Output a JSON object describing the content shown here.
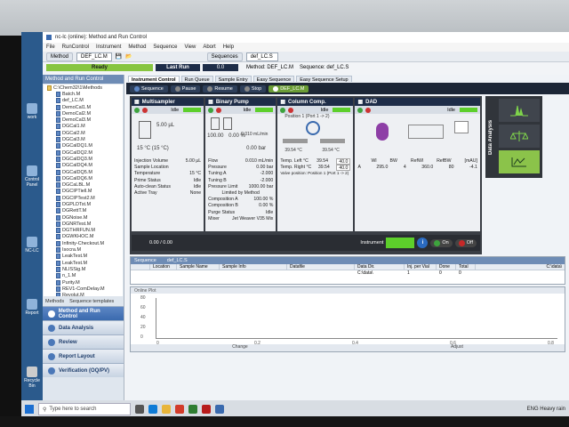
{
  "window": {
    "title": "nc-lc (online): Method and Run Control",
    "menu": [
      "File",
      "RunControl",
      "Instrument",
      "Method",
      "Sequence",
      "View",
      "Abort",
      "Help"
    ]
  },
  "toolbar": {
    "method_label": "Method",
    "method_value": "DEF_LC.M",
    "sequences_label": "Sequences",
    "sequence_value": "def_LC.S"
  },
  "status": {
    "ready": "Ready",
    "last_run": "Last Run",
    "last_run_value": "0.0",
    "method_file": "Method: DEF_LC.M",
    "sequence_file": "Sequence: def_LC.S"
  },
  "nav": {
    "title": "Method and Run Control",
    "root": "C:\\Chem32\\1\\Methods",
    "items": [
      "Batch.M",
      "def_LC.M",
      "DemoCal1.M",
      "DemoCal2.M",
      "DemoCal3.M",
      "DGCal1.M",
      "DGCal2.M",
      "DGCal3.M",
      "DGCalDQ1.M",
      "DGCalDQ2.M",
      "DGCalDQ3.M",
      "DGCalDQ4.M",
      "DGCalDQ5.M",
      "DGCalDQ6.M",
      "DGCaLBL.M",
      "DGCIPTiell.M",
      "DGCIPTest2.M",
      "DGPLDTst.M",
      "DGRettT.M",
      "DGNoise.M",
      "DGNRTest.M",
      "DGTHRFUN.M",
      "DGWKHOC.M",
      "Infinity-Checkout.M",
      "Isocra.M",
      "LeakTest.M",
      "LeakTest.M",
      "NLISSig.M",
      "n_1.M",
      "Purity.M",
      "REV1-ComDelay.M",
      "Revolut.M",
      "RSLC1Check.M"
    ],
    "tabs": [
      "Methods",
      "Sequence templates"
    ],
    "views": [
      "Method and Run Control",
      "Data Analysis",
      "Review",
      "Report Layout",
      "Verification (OQ/PV)"
    ]
  },
  "main_tabs": [
    "Instrument Control",
    "Run Queue",
    "Sample Entry",
    "Easy Sequence",
    "Easy Sequence Setup"
  ],
  "seqbar": {
    "buttons": [
      "Sequence",
      "Pause",
      "Resume",
      "Stop"
    ],
    "method": "DEF_LC.M"
  },
  "modules": {
    "sampler": {
      "title": "Multisampler",
      "idle": "Idle",
      "volume": "5.00 µL",
      "temp": "15 °C (15 °C)",
      "rows": [
        [
          "Injection Volume",
          "5.00 µL"
        ],
        [
          "Sample Location",
          ""
        ],
        [
          "Temperature",
          "15 °C"
        ],
        [
          "Prime Status",
          "Idle"
        ],
        [
          "Auto-clean Status",
          "Idle"
        ],
        [
          "Active Tray",
          "None"
        ]
      ]
    },
    "pump": {
      "title": "Binary Pump",
      "idle": "Idle",
      "a": "100.00",
      "b": "0.00 %",
      "flow_small": "0.010 mL/min",
      "bar": "0.00 bar",
      "rows": [
        [
          "Flow",
          "0.010 mL/min"
        ],
        [
          "Pressure",
          "0.00 bar"
        ],
        [
          "Tuning A",
          "-2.000"
        ],
        [
          "Tuning B",
          "-2.000"
        ],
        [
          "Pressure Limit",
          "1000.00 bar"
        ]
      ],
      "limited": "Limited by Method",
      "rows2": [
        [
          "Composition A",
          "100.00 %"
        ],
        [
          "Composition B",
          "0.00 %"
        ],
        [
          "Purge Status",
          "Idle"
        ],
        [
          "Mixer",
          "Jet Weaver V35 Mix"
        ]
      ]
    },
    "column": {
      "title": "Column Comp.",
      "idle": "Idle",
      "position": "Position 1 (Port 1 -> 2)",
      "left_temp": "39.54 °C",
      "right_temp": "39.54 °C",
      "rows": [
        [
          "Temp. Left °C",
          "39.54",
          "40.0"
        ],
        [
          "Temp. Right °C",
          "39.54",
          "40.0"
        ]
      ],
      "valve": "Valve position: Position 1 (Port 1 -> 2)"
    },
    "dad": {
      "title": "DAD",
      "idle": "Idle",
      "cols": [
        "Wl",
        "BW",
        "RefWl",
        "RefBW",
        "[mAU]"
      ],
      "row": [
        "A",
        "295.0",
        "4",
        "360.0",
        "80",
        "-4.1"
      ]
    }
  },
  "instrument_status": {
    "label": "Instrument",
    "state": "Idle",
    "on": "On",
    "off": "Off"
  },
  "data_analysis": "Data Analysis",
  "sequence_panel": {
    "title": "Sequence",
    "file": "def_LC.S",
    "cols": [
      "Location",
      "Sample Name",
      "Sample Info",
      "Datafile",
      "Data Dir.",
      "Inj. per Vial",
      "Done",
      "Total"
    ],
    "row": [
      "",
      "",
      "",
      "",
      "C:\\data\\",
      "1",
      "0",
      "0"
    ],
    "right": "C:\\data\\"
  },
  "plot": {
    "title": "Online Plot",
    "yticks": [
      "80",
      "60",
      "40",
      "20",
      "0"
    ],
    "xticks": [
      "0",
      "0.2",
      "0.4",
      "0.6",
      "0.8"
    ],
    "change": "Change",
    "adjust": "Adjust",
    "counter": "0.00 / 0.00"
  },
  "taskbar": {
    "search": "Type here to search",
    "tray": "ENG  Heavy rain"
  },
  "desktop": [
    "Recycle Bin",
    "work",
    "Control Panel",
    "NC-LC",
    "Report"
  ],
  "colors": {
    "accent": "#3a6aae",
    "ready": "#87c540",
    "idle": "#5dcf2b",
    "on": "#3da33d",
    "off": "#c62828"
  }
}
